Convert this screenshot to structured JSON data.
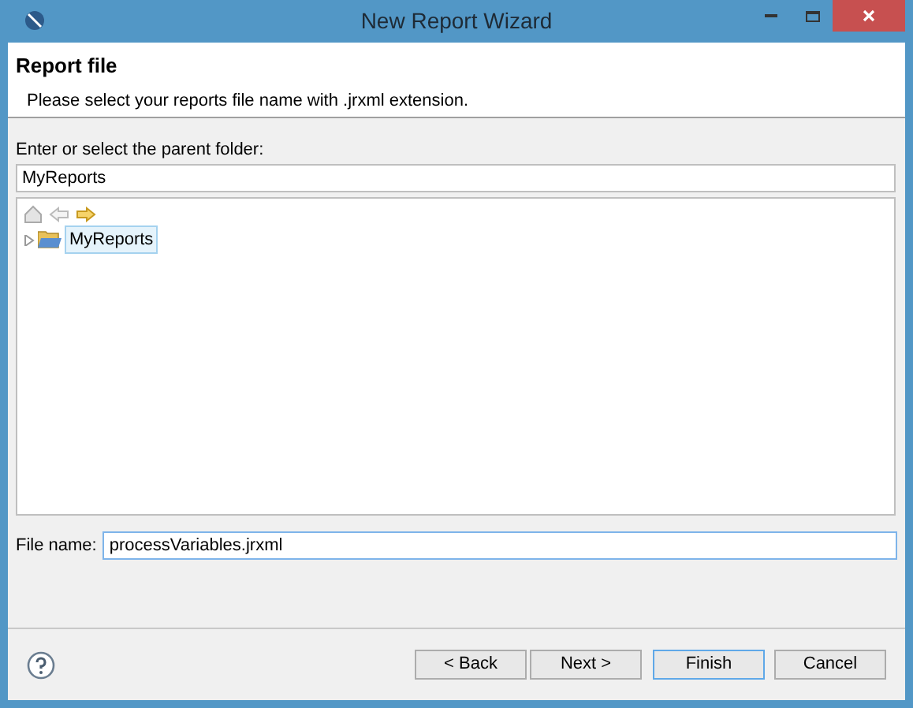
{
  "window": {
    "title": "New Report Wizard"
  },
  "header": {
    "title": "Report file",
    "description": "Please select your reports file name with .jrxml extension."
  },
  "parent_folder": {
    "label": "Enter or select the parent folder:",
    "value": "MyReports"
  },
  "tree": {
    "items": [
      {
        "label": "MyReports",
        "expanded": false,
        "selected": true
      }
    ]
  },
  "file_name": {
    "label": "File name:",
    "value": "processVariables.jrxml"
  },
  "buttons": [
    {
      "label": "< Back",
      "default": false
    },
    {
      "label": "Next >",
      "default": false
    },
    {
      "label": "Finish",
      "default": true
    },
    {
      "label": "Cancel",
      "default": false
    }
  ]
}
